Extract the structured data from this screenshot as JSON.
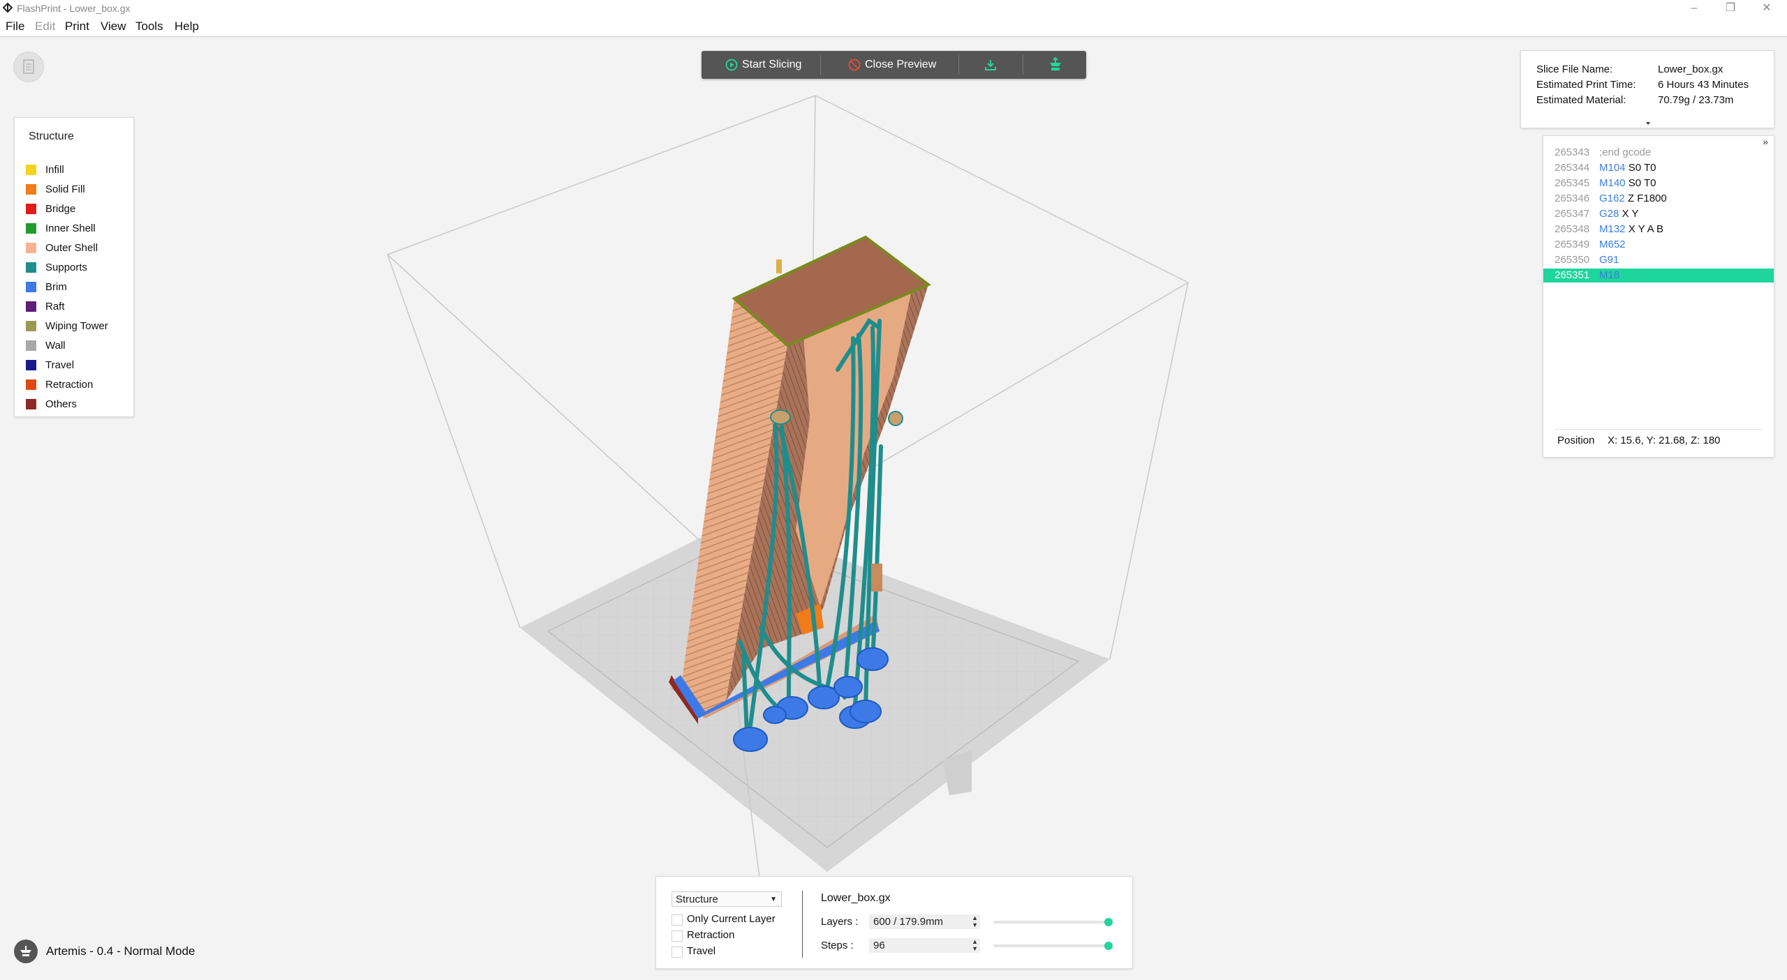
{
  "window": {
    "title": "FlashPrint - Lower_box.gx",
    "minimize_icon": "minimize-icon",
    "restore_icon": "restore-icon",
    "close_icon": "close-icon"
  },
  "menu": [
    "File",
    "Edit",
    "Print",
    "View",
    "Tools",
    "Help"
  ],
  "menu_disabled": [
    "Edit"
  ],
  "toolbar": {
    "start_slicing": "Start Slicing",
    "close_preview": "Close Preview",
    "export_icon": "download-icon",
    "print_icon": "printer-send-icon"
  },
  "legend": {
    "title": "Structure",
    "items": [
      {
        "label": "Infill",
        "color": "#f7d21d"
      },
      {
        "label": "Solid Fill",
        "color": "#f07d19"
      },
      {
        "label": "Bridge",
        "color": "#e01b1b"
      },
      {
        "label": "Inner Shell",
        "color": "#1f9a2f"
      },
      {
        "label": "Outer Shell",
        "color": "#f6b493"
      },
      {
        "label": "Supports",
        "color": "#1f8d8d"
      },
      {
        "label": "Brim",
        "color": "#3d7ae8"
      },
      {
        "label": "Raft",
        "color": "#5c1f78"
      },
      {
        "label": "Wiping Tower",
        "color": "#9a9a52"
      },
      {
        "label": "Wall",
        "color": "#a8a8a8"
      },
      {
        "label": "Travel",
        "color": "#1a1a8c"
      },
      {
        "label": "Retraction",
        "color": "#e04a12"
      },
      {
        "label": "Others",
        "color": "#8e2a24"
      }
    ]
  },
  "slice_info": {
    "file_label": "Slice File Name:",
    "file_value": "Lower_box.gx",
    "time_label": "Estimated Print Time:",
    "time_value": "6 Hours 43 Minutes",
    "material_label": "Estimated Material:",
    "material_value": "70.79g / 23.73m"
  },
  "gcode": {
    "lines": [
      {
        "num": "265343",
        "cmd": ";end gcode",
        "args": "",
        "comment": true
      },
      {
        "num": "265344",
        "cmd": "M104",
        "args": " S0 T0"
      },
      {
        "num": "265345",
        "cmd": "M140",
        "args": " S0 T0"
      },
      {
        "num": "265346",
        "cmd": "G162",
        "args": " Z F1800"
      },
      {
        "num": "265347",
        "cmd": "G28",
        "args": " X Y"
      },
      {
        "num": "265348",
        "cmd": "M132",
        "args": " X Y A B"
      },
      {
        "num": "265349",
        "cmd": "M652",
        "args": ""
      },
      {
        "num": "265350",
        "cmd": "G91",
        "args": ""
      },
      {
        "num": "265351",
        "cmd": "M18",
        "args": "",
        "selected": true
      }
    ],
    "position_label": "Position",
    "position_value": "X: 15.6, Y: 21.68, Z: 180",
    "collapse_icon": "double-chevron-right-icon"
  },
  "bottom": {
    "view_mode": "Structure",
    "checkboxes": [
      {
        "label": "Only Current Layer",
        "checked": false
      },
      {
        "label": "Retraction",
        "checked": false
      },
      {
        "label": "Travel",
        "checked": false
      }
    ],
    "file_name": "Lower_box.gx",
    "layers_label": "Layers :",
    "layers_value": "600 / 179.9mm",
    "layers_fraction": 1.0,
    "steps_label": "Steps :",
    "steps_value": "96",
    "steps_fraction": 1.0
  },
  "status": {
    "machine": "Artemis - 0.4 - Normal Mode"
  },
  "colors": {
    "accent": "#1ed59d",
    "link_blue": "#3a7ee0",
    "toolbar_bg": "#555555",
    "support": "#1f8d8d",
    "brim": "#3d7ae8",
    "shell": "#e7b18f"
  }
}
